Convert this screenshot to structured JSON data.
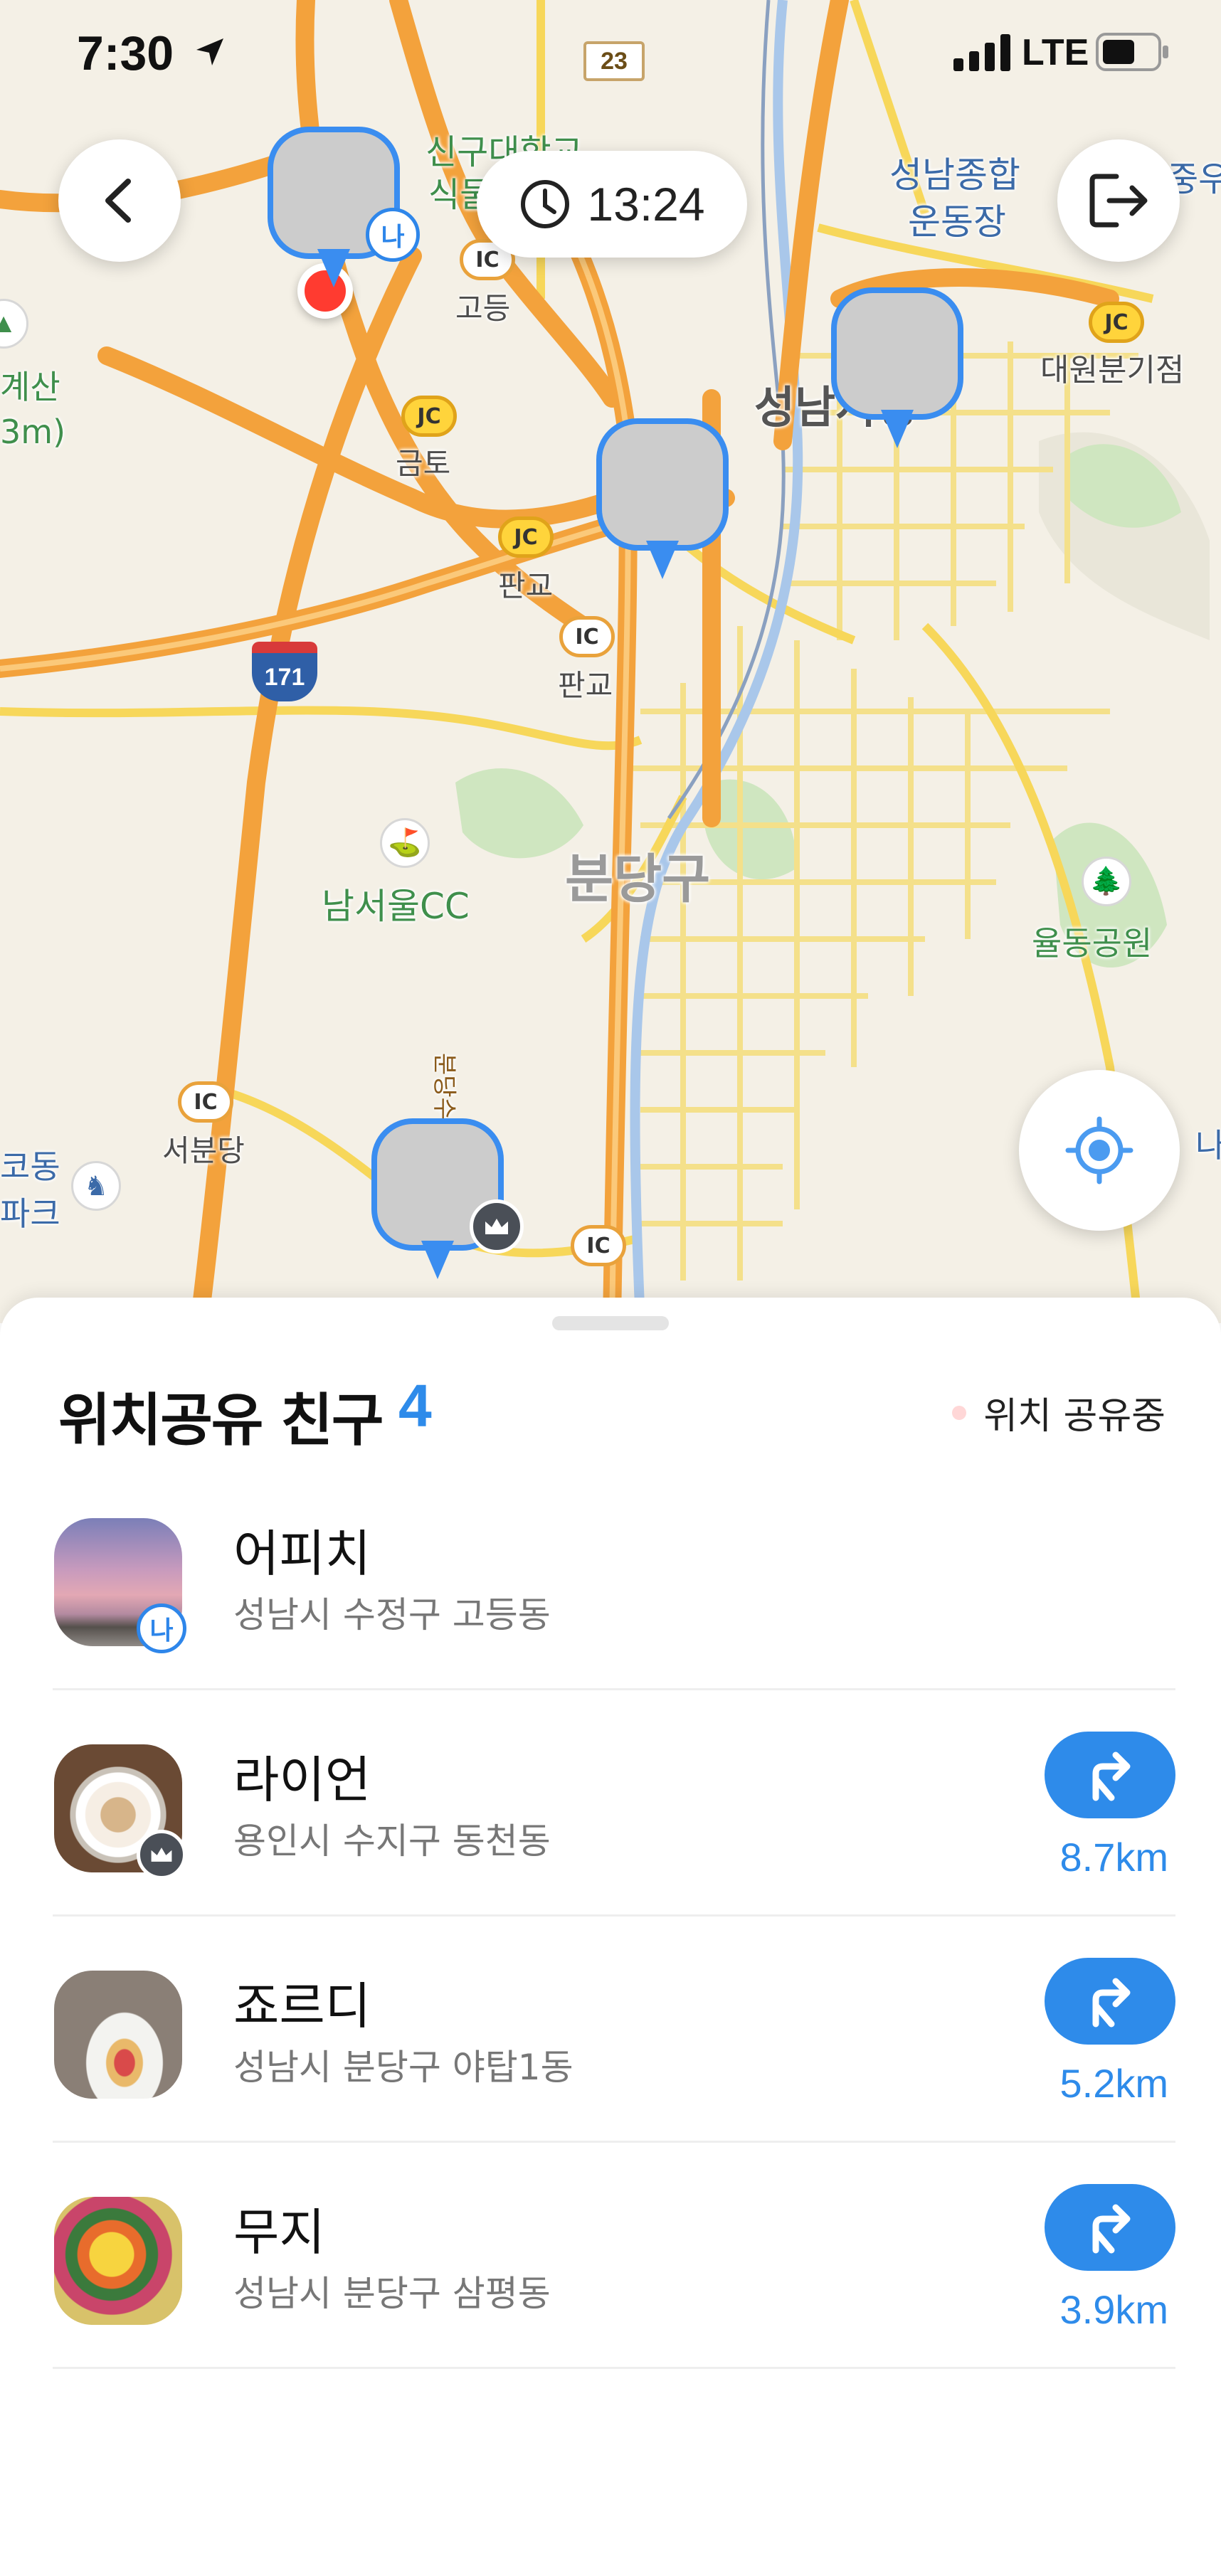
{
  "status_bar": {
    "time": "7:30",
    "network": "LTE"
  },
  "map": {
    "time_pill": "13:24",
    "labels": {
      "singu": "신구대학교",
      "singu2": "식물원",
      "seongnam_stadium": "성남종합",
      "seongnam_stadium2": "운동장",
      "daewon": "대원분기점",
      "seongnam_city": "성남시청",
      "godeung": "고등",
      "geumto": "금토",
      "pangyo_jc": "판교",
      "pangyo_ic": "판교",
      "namseoul_cc": "남서울CC",
      "bundang_gu": "분당구",
      "bundang_road": "분당수서고속도로",
      "yuldong": "율동공원",
      "seobundang": "서분당",
      "left_top1": "계산",
      "left_top2": "3m)",
      "left_bottom1": "코동",
      "left_bottom2": "파크",
      "right_edge1": "중우",
      "right_edge2": "나파",
      "route_23": "23",
      "route_171": "171",
      "ic": "IC",
      "jc": "JC"
    },
    "pins": [
      {
        "friend": "어피치",
        "badge": "나"
      },
      {
        "friend": "죠르디"
      },
      {
        "friend": "무지"
      },
      {
        "friend": "라이언",
        "badge": "crown"
      }
    ]
  },
  "sheet": {
    "title": "위치공유 친구",
    "count": "4",
    "legend": "위치 공유중",
    "friends": [
      {
        "name": "어피치",
        "address": "성남시 수정구 고등동",
        "badge": "나",
        "distance": ""
      },
      {
        "name": "라이언",
        "address": "용인시 수지구 동천동",
        "badge": "crown",
        "distance": "8.7km"
      },
      {
        "name": "죠르디",
        "address": "성남시 분당구 야탑1동",
        "distance": "5.2km"
      },
      {
        "name": "무지",
        "address": "성남시 분당구 삼평동",
        "distance": "3.9km"
      }
    ]
  },
  "colors": {
    "accent": "#2e8bea",
    "highway": "#f3a23c",
    "road": "#f7e27a"
  }
}
